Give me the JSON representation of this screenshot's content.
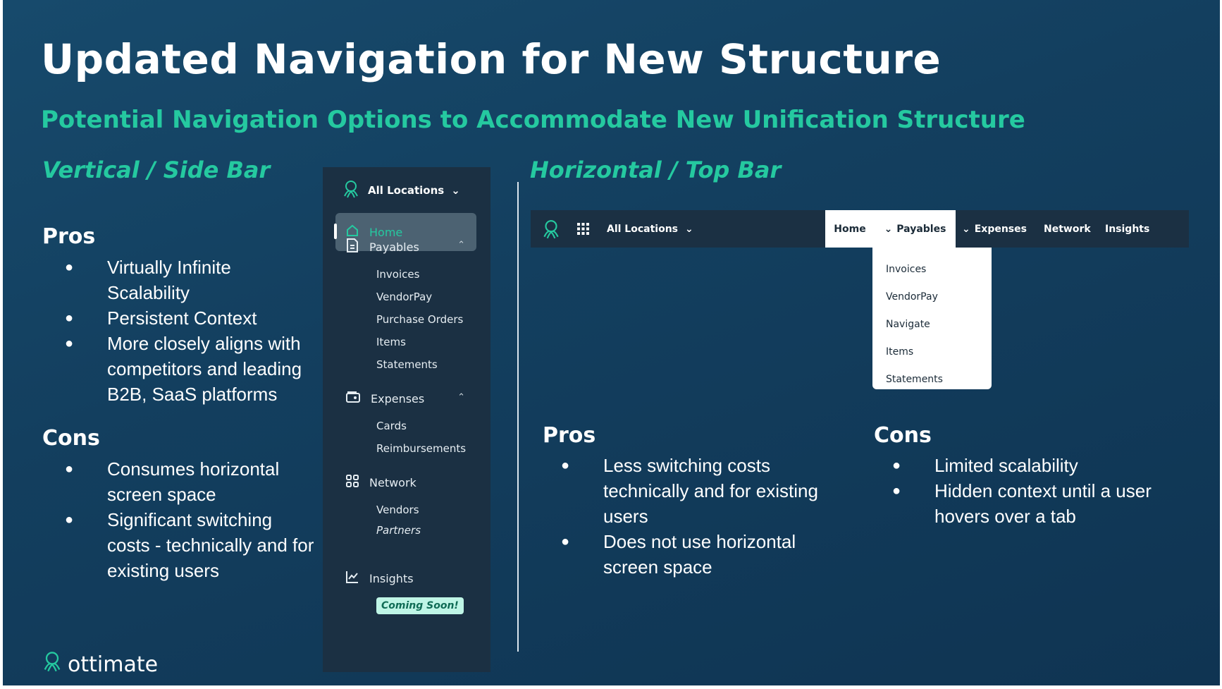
{
  "title": "Updated Navigation for New Structure",
  "subtitle": "Potential Navigation Options to Accommodate New Unification Structure",
  "vertical": {
    "heading": "Vertical / Side Bar",
    "pros_label": "Pros",
    "pros": [
      "Virtually Infinite Scalability",
      "Persistent Context",
      "More closely aligns with competitors and leading B2B, SaaS platforms"
    ],
    "cons_label": "Cons",
    "cons": [
      "Consumes horizontal screen space",
      "Significant switching costs - technically and for existing users"
    ]
  },
  "sidebar": {
    "location": "All Locations",
    "home": "Home",
    "payables": "Payables",
    "payables_items": [
      "Invoices",
      "VendorPay",
      "Purchase Orders",
      "Items",
      "Statements"
    ],
    "expenses": "Expenses",
    "expenses_items": [
      "Cards",
      "Reimbursements"
    ],
    "network": "Network",
    "network_items": [
      "Vendors",
      "Partners"
    ],
    "coming_soon": "Coming Soon!",
    "insights": "Insights"
  },
  "horizontal": {
    "heading": "Horizontal / Top Bar",
    "pros_label": "Pros",
    "pros": [
      "Less switching costs technically and for existing users",
      "Does not use horizontal screen space"
    ],
    "cons_label": "Cons",
    "cons": [
      "Limited scalability",
      "Hidden context until a user hovers over a tab"
    ]
  },
  "topbar": {
    "location": "All Locations",
    "home": "Home",
    "payables": "Payables",
    "expenses": "Expenses",
    "network": "Network",
    "insights": "Insights",
    "dropdown": [
      "Invoices",
      "VendorPay",
      "Navigate",
      "Items",
      "Statements"
    ]
  },
  "logo": "ottimate",
  "colors": {
    "accent": "#25c9a0",
    "background": "#133f5f",
    "nav": "#1b3043"
  }
}
